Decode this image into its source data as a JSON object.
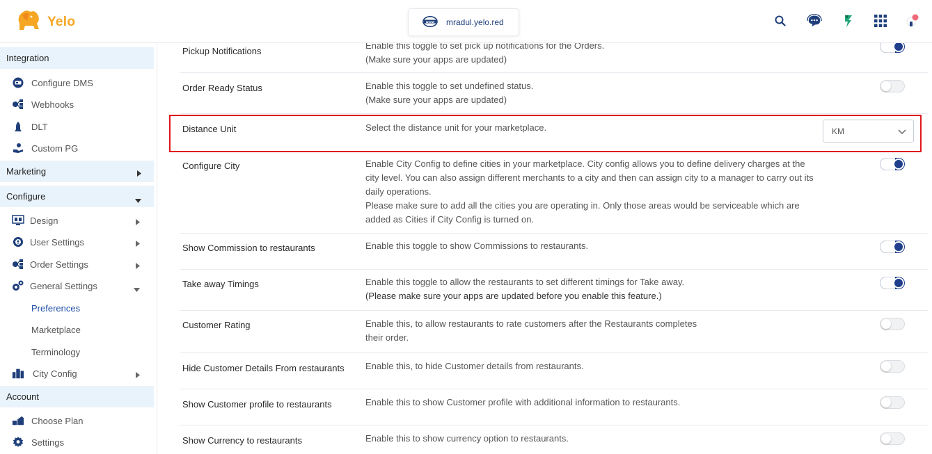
{
  "brand": {
    "name": "Yelo",
    "accent": "#f5a623",
    "primary": "#1f3f8c"
  },
  "header": {
    "domain": "mradul.yelo.red",
    "icons": [
      "search-icon",
      "support-chat-icon",
      "app-switch-icon",
      "grid-apps-icon",
      "user-avatar-icon"
    ]
  },
  "sidebar": {
    "integration": {
      "heading": "Integration",
      "items": [
        {
          "label": "Configure DMS",
          "icon": "dms-icon"
        },
        {
          "label": "Webhooks",
          "icon": "webhooks-icon"
        },
        {
          "label": "DLT",
          "icon": "dlt-icon"
        },
        {
          "label": "Custom PG",
          "icon": "custom-pg-icon"
        }
      ]
    },
    "marketing": {
      "heading": "Marketing"
    },
    "configure": {
      "heading": "Configure",
      "items": [
        {
          "label": "Design",
          "icon": "design-icon"
        },
        {
          "label": "User Settings",
          "icon": "user-settings-icon"
        },
        {
          "label": "Order Settings",
          "icon": "order-settings-icon"
        },
        {
          "label": "General Settings",
          "icon": "general-settings-icon"
        }
      ],
      "subitems": [
        {
          "label": "Preferences",
          "active": true
        },
        {
          "label": "Marketplace",
          "active": false
        },
        {
          "label": "Terminology",
          "active": false
        }
      ],
      "city_config": "City Config"
    },
    "account": {
      "heading": "Account",
      "items": [
        {
          "label": "Choose Plan",
          "icon": "choose-plan-icon"
        },
        {
          "label": "Settings",
          "icon": "settings-icon"
        }
      ]
    }
  },
  "rows": [
    {
      "title": "Pickup Notifications",
      "desc": [
        "Enable this toggle to set pick up notifications for the Orders.",
        "(Make sure your apps are updated)"
      ],
      "toggle": true
    },
    {
      "title": "Order Ready Status",
      "desc": [
        "Enable this toggle to set undefined status.",
        "(Make sure your apps are updated)"
      ],
      "toggle": false
    },
    {
      "title": "Distance Unit",
      "desc": [
        "Select the distance unit for your marketplace."
      ],
      "select_value": "KM"
    },
    {
      "title": "Configure City",
      "desc": [
        "Enable City Config to define cities in your marketplace. City config allows you to define delivery charges at the",
        "city level. You can also assign different merchants to a city and then can assign city to a manager to carry out its",
        "daily operations.",
        "Please make sure to add all the cities you are operating in. Only those areas would be serviceable which are",
        "added as Cities if City Config is turned on."
      ],
      "toggle": true
    },
    {
      "title": "Show Commission to restaurants",
      "desc": [
        "Enable this toggle to show Commissions to restaurants."
      ],
      "toggle": true
    },
    {
      "title": "Take away Timings",
      "desc": [
        "Enable this toggle to allow the restaurants to set different timings for Take away.",
        "(Please make sure your apps are updated before you enable this feature.)"
      ],
      "toggle": true
    },
    {
      "title": "Customer Rating",
      "desc": [
        "Enable this, to allow restaurants to rate customers after the Restaurants completes",
        "their order."
      ],
      "toggle": false
    },
    {
      "title": "Hide Customer Details From restaurants",
      "desc": [
        "Enable this, to hide Customer details from restaurants."
      ],
      "toggle": false
    },
    {
      "title": "Show Customer profile to restaurants",
      "desc": [
        "Enable this to show Customer profile with additional information to restaurants."
      ],
      "toggle": false
    },
    {
      "title": "Show Currency to restaurants",
      "desc": [
        "Enable this to show currency option to restaurants."
      ],
      "toggle": false
    }
  ]
}
